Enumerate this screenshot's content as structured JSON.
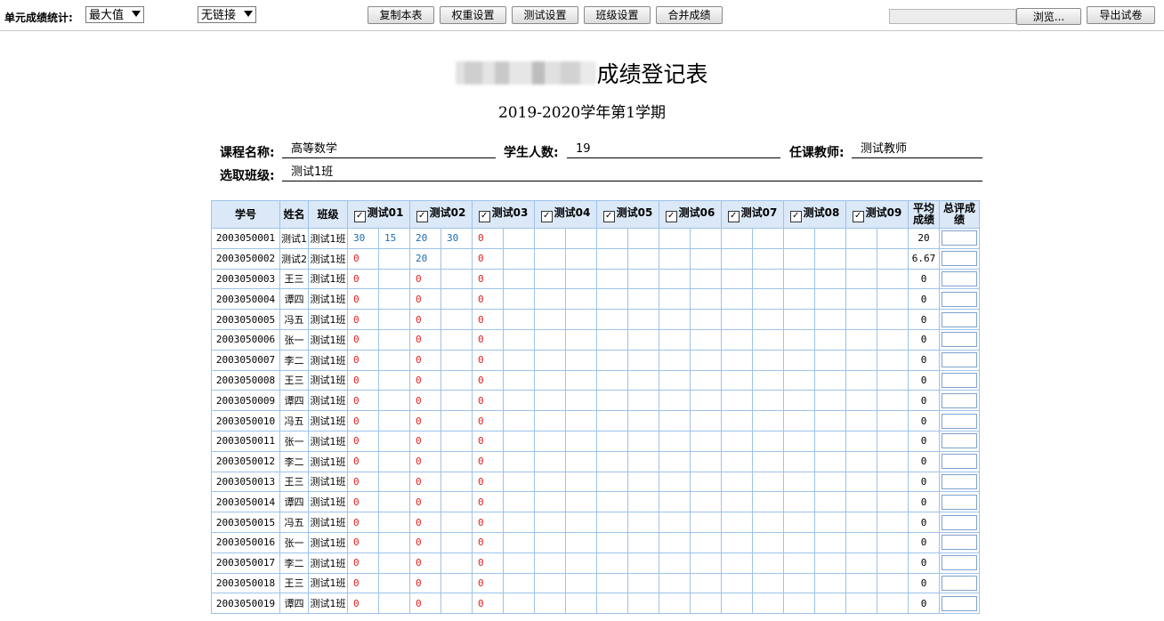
{
  "toolbar": {
    "unit_stat_label": "单元成绩统计:",
    "stat_select_value": "最大值",
    "link_select_value": "无链接",
    "buttons": [
      "复制本表",
      "权重设置",
      "测试设置",
      "班级设置",
      "合并成绩"
    ],
    "browse_label": "浏览...",
    "export_label": "导出试卷"
  },
  "header": {
    "title": "成绩登记表",
    "subtitle": "2019-2020学年第1学期"
  },
  "info": {
    "course_label": "课程名称:",
    "course_value": "高等数学",
    "count_label": "学生人数:",
    "count_value": "19",
    "teacher_label": "任课教师:",
    "teacher_value": "测试教师",
    "class_label": "选取班级:",
    "class_value": "测试1班"
  },
  "table": {
    "col_id": "学号",
    "col_name": "姓名",
    "col_class": "班级",
    "tests": [
      "测试01",
      "测试02",
      "测试03",
      "测试04",
      "测试05",
      "测试06",
      "测试07",
      "测试08",
      "测试09"
    ],
    "col_avg": "平均成绩",
    "col_total": "总评成绩",
    "rows": [
      {
        "id": "2003050001",
        "name": "测试1",
        "cls": "测试1班",
        "scores": [
          "30",
          "15",
          "20",
          "30",
          "0",
          "",
          "",
          "",
          "",
          "",
          "",
          "",
          "",
          "",
          "",
          "",
          "",
          ""
        ],
        "avg": "20"
      },
      {
        "id": "2003050002",
        "name": "测试2",
        "cls": "测试1班",
        "scores": [
          "0",
          "",
          "20",
          "",
          "0",
          "",
          "",
          "",
          "",
          "",
          "",
          "",
          "",
          "",
          "",
          "",
          "",
          ""
        ],
        "avg": "6.67"
      },
      {
        "id": "2003050003",
        "name": "王三",
        "cls": "测试1班",
        "scores": [
          "0",
          "",
          "0",
          "",
          "0",
          "",
          "",
          "",
          "",
          "",
          "",
          "",
          "",
          "",
          "",
          "",
          "",
          ""
        ],
        "avg": "0"
      },
      {
        "id": "2003050004",
        "name": "谭四",
        "cls": "测试1班",
        "scores": [
          "0",
          "",
          "0",
          "",
          "0",
          "",
          "",
          "",
          "",
          "",
          "",
          "",
          "",
          "",
          "",
          "",
          "",
          ""
        ],
        "avg": "0"
      },
      {
        "id": "2003050005",
        "name": "冯五",
        "cls": "测试1班",
        "scores": [
          "0",
          "",
          "0",
          "",
          "0",
          "",
          "",
          "",
          "",
          "",
          "",
          "",
          "",
          "",
          "",
          "",
          "",
          ""
        ],
        "avg": "0"
      },
      {
        "id": "2003050006",
        "name": "张一",
        "cls": "测试1班",
        "scores": [
          "0",
          "",
          "0",
          "",
          "0",
          "",
          "",
          "",
          "",
          "",
          "",
          "",
          "",
          "",
          "",
          "",
          "",
          ""
        ],
        "avg": "0"
      },
      {
        "id": "2003050007",
        "name": "李二",
        "cls": "测试1班",
        "scores": [
          "0",
          "",
          "0",
          "",
          "0",
          "",
          "",
          "",
          "",
          "",
          "",
          "",
          "",
          "",
          "",
          "",
          "",
          ""
        ],
        "avg": "0"
      },
      {
        "id": "2003050008",
        "name": "王三",
        "cls": "测试1班",
        "scores": [
          "0",
          "",
          "0",
          "",
          "0",
          "",
          "",
          "",
          "",
          "",
          "",
          "",
          "",
          "",
          "",
          "",
          "",
          ""
        ],
        "avg": "0"
      },
      {
        "id": "2003050009",
        "name": "谭四",
        "cls": "测试1班",
        "scores": [
          "0",
          "",
          "0",
          "",
          "0",
          "",
          "",
          "",
          "",
          "",
          "",
          "",
          "",
          "",
          "",
          "",
          "",
          ""
        ],
        "avg": "0"
      },
      {
        "id": "2003050010",
        "name": "冯五",
        "cls": "测试1班",
        "scores": [
          "0",
          "",
          "0",
          "",
          "0",
          "",
          "",
          "",
          "",
          "",
          "",
          "",
          "",
          "",
          "",
          "",
          "",
          ""
        ],
        "avg": "0"
      },
      {
        "id": "2003050011",
        "name": "张一",
        "cls": "测试1班",
        "scores": [
          "0",
          "",
          "0",
          "",
          "0",
          "",
          "",
          "",
          "",
          "",
          "",
          "",
          "",
          "",
          "",
          "",
          "",
          ""
        ],
        "avg": "0"
      },
      {
        "id": "2003050012",
        "name": "李二",
        "cls": "测试1班",
        "scores": [
          "0",
          "",
          "0",
          "",
          "0",
          "",
          "",
          "",
          "",
          "",
          "",
          "",
          "",
          "",
          "",
          "",
          "",
          ""
        ],
        "avg": "0"
      },
      {
        "id": "2003050013",
        "name": "王三",
        "cls": "测试1班",
        "scores": [
          "0",
          "",
          "0",
          "",
          "0",
          "",
          "",
          "",
          "",
          "",
          "",
          "",
          "",
          "",
          "",
          "",
          "",
          ""
        ],
        "avg": "0"
      },
      {
        "id": "2003050014",
        "name": "谭四",
        "cls": "测试1班",
        "scores": [
          "0",
          "",
          "0",
          "",
          "0",
          "",
          "",
          "",
          "",
          "",
          "",
          "",
          "",
          "",
          "",
          "",
          "",
          ""
        ],
        "avg": "0"
      },
      {
        "id": "2003050015",
        "name": "冯五",
        "cls": "测试1班",
        "scores": [
          "0",
          "",
          "0",
          "",
          "0",
          "",
          "",
          "",
          "",
          "",
          "",
          "",
          "",
          "",
          "",
          "",
          "",
          ""
        ],
        "avg": "0"
      },
      {
        "id": "2003050016",
        "name": "张一",
        "cls": "测试1班",
        "scores": [
          "0",
          "",
          "0",
          "",
          "0",
          "",
          "",
          "",
          "",
          "",
          "",
          "",
          "",
          "",
          "",
          "",
          "",
          ""
        ],
        "avg": "0"
      },
      {
        "id": "2003050017",
        "name": "李二",
        "cls": "测试1班",
        "scores": [
          "0",
          "",
          "0",
          "",
          "0",
          "",
          "",
          "",
          "",
          "",
          "",
          "",
          "",
          "",
          "",
          "",
          "",
          ""
        ],
        "avg": "0"
      },
      {
        "id": "2003050018",
        "name": "王三",
        "cls": "测试1班",
        "scores": [
          "0",
          "",
          "0",
          "",
          "0",
          "",
          "",
          "",
          "",
          "",
          "",
          "",
          "",
          "",
          "",
          "",
          "",
          ""
        ],
        "avg": "0"
      },
      {
        "id": "2003050019",
        "name": "谭四",
        "cls": "测试1班",
        "scores": [
          "0",
          "",
          "0",
          "",
          "0",
          "",
          "",
          "",
          "",
          "",
          "",
          "",
          "",
          "",
          "",
          "",
          "",
          ""
        ],
        "avg": "0"
      }
    ]
  },
  "colors": {
    "grid_border": "#9dc3ea",
    "header_bg": "#dbe8f7",
    "score_blue": "#1b6cb0",
    "score_red": "#e02020"
  }
}
